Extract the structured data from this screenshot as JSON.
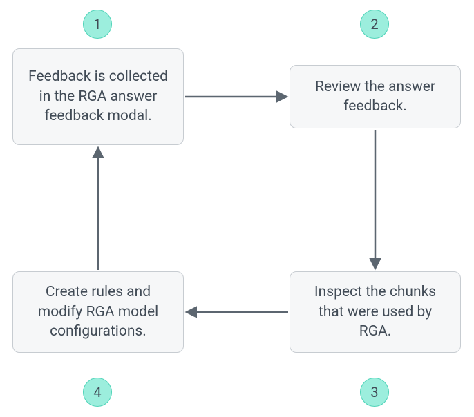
{
  "diagram": {
    "nodes": {
      "n1": {
        "label": "1",
        "text": "Feedback is collected in the RGA answer feedback modal."
      },
      "n2": {
        "label": "2",
        "text": "Review the answer feedback."
      },
      "n3": {
        "label": "3",
        "text": "Inspect the chunks that were used by RGA."
      },
      "n4": {
        "label": "4",
        "text": "Create rules and modify RGA model configurations."
      }
    },
    "flow": [
      "n1",
      "n2",
      "n3",
      "n4",
      "n1"
    ],
    "colors": {
      "badge_bg": "#9ceedd",
      "badge_border": "#4fd3b8",
      "node_bg": "#f6f7f8",
      "node_border": "#c7ccd1",
      "arrow": "#5c6670"
    }
  }
}
